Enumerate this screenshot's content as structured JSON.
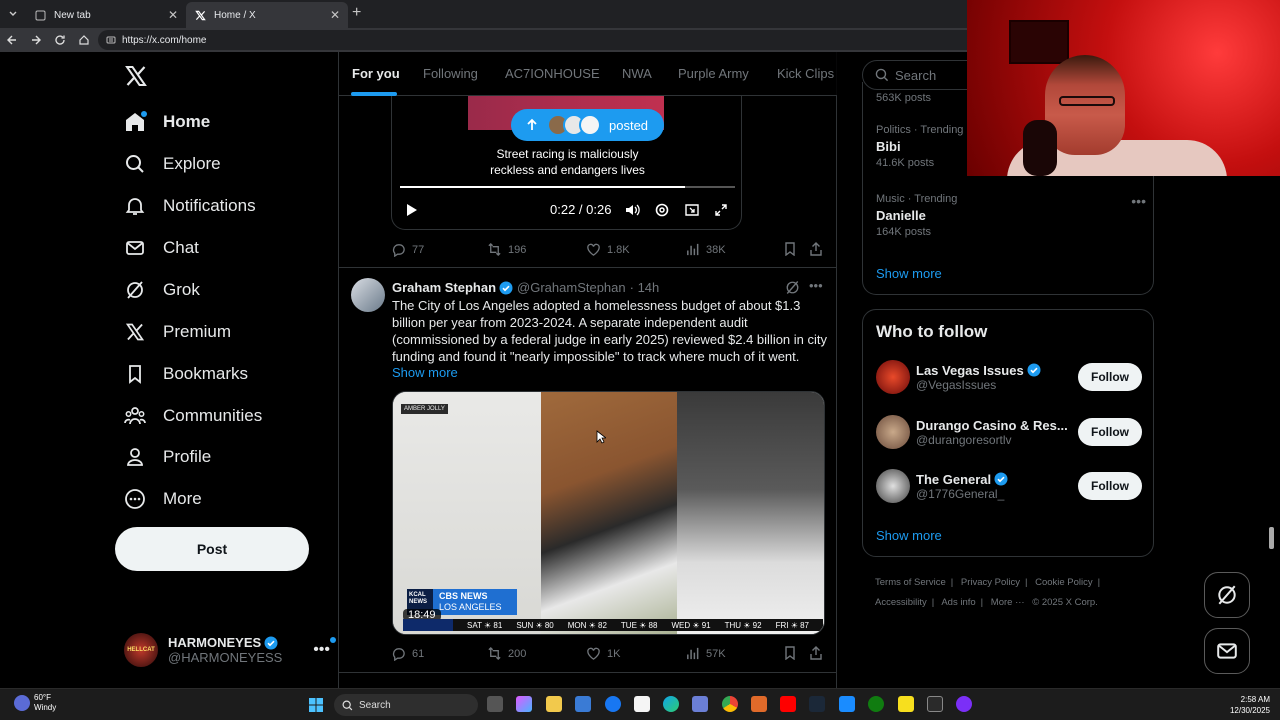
{
  "browser": {
    "tabs": [
      {
        "title": "New tab",
        "close": "✕"
      },
      {
        "title": "Home / X",
        "close": "✕"
      }
    ],
    "new_tab": "+",
    "url": "https://x.com/home"
  },
  "nav": {
    "items": [
      {
        "label": "Home",
        "icon": "home-icon"
      },
      {
        "label": "Explore",
        "icon": "search-icon"
      },
      {
        "label": "Notifications",
        "icon": "bell-icon"
      },
      {
        "label": "Chat",
        "icon": "mail-icon"
      },
      {
        "label": "Grok",
        "icon": "grok-icon"
      },
      {
        "label": "Premium",
        "icon": "x-icon"
      },
      {
        "label": "Bookmarks",
        "icon": "bookmark-icon"
      },
      {
        "label": "Communities",
        "icon": "people-icon"
      },
      {
        "label": "Profile",
        "icon": "person-icon"
      },
      {
        "label": "More",
        "icon": "more-circle-icon"
      }
    ],
    "post_label": "Post",
    "account": {
      "name": "HARMONEYES",
      "handle": "@HARMONEYESS",
      "avatar_text": "HELLCAT",
      "more": "•••"
    }
  },
  "feed": {
    "tabs": [
      "For you",
      "Following",
      "AC7IONHOUSE",
      "NWA",
      "Purple Army",
      "Kick Clips"
    ],
    "posted_pill": "posted",
    "video": {
      "caption_line1": "Street racing is maliciously",
      "caption_line2": "reckless and endangers lives",
      "time": "0:22 / 0:26",
      "progress": 0.85
    },
    "tweet1_actions": {
      "replies": "77",
      "reposts": "196",
      "likes": "1.8K",
      "views": "38K"
    },
    "tweet2": {
      "name": "Graham Stephan",
      "handle": "@GrahamStephan",
      "time": "· 14h",
      "text": "The City of Los Angeles adopted a homelessness budget of about $1.3 billion per year from 2023-2024. A separate independent audit (commissioned by a federal judge in early 2025) reviewed $2.4 billion in city funding and found it \"nearly impossible\" to track where much of it went.",
      "show_more": "Show more",
      "media": {
        "watermark": "AMBER JOLLY",
        "station": "KCAL NEWS",
        "network": "CBS NEWS",
        "network_sub": "LOS ANGELES",
        "duration": "18:49",
        "ticker": [
          "SAT ☀ 81",
          "SUN ☀ 80",
          "MON ☀ 82",
          "TUE ☀ 88",
          "WED ☀ 91",
          "THU ☀ 92",
          "FRI ☀ 87"
        ]
      },
      "actions": {
        "replies": "61",
        "reposts": "200",
        "likes": "1K",
        "views": "57K"
      },
      "more": "•••"
    }
  },
  "right": {
    "search_placeholder": "Search",
    "trends_top_count": "563K posts",
    "trends": [
      {
        "category": "Politics · Trending",
        "title": "Bibi",
        "count": "41.6K posts"
      },
      {
        "category": "Music · Trending",
        "title": "Danielle",
        "count": "164K posts",
        "more": "•••"
      }
    ],
    "trends_show_more": "Show more",
    "who_to_follow": {
      "title": "Who to follow",
      "accounts": [
        {
          "name": "Las Vegas Issues",
          "handle": "@VegasIssues",
          "verified": true
        },
        {
          "name": "Durango Casino & Res...",
          "handle": "@durangoresortlv",
          "verified": false
        },
        {
          "name": "The General",
          "handle": "@1776General_",
          "verified": true
        }
      ],
      "follow_label": "Follow",
      "show_more": "Show more"
    },
    "footer": [
      "Terms of Service",
      "|",
      "Privacy Policy",
      "|",
      "Cookie Policy",
      "|",
      "Accessibility",
      "|",
      "Ads info",
      "|",
      "More ···",
      "© 2025 X Corp."
    ]
  },
  "taskbar": {
    "weather_temp": "60°F",
    "weather_desc": "Windy",
    "search": "Search",
    "time": "2:58 AM",
    "date": "12/30/2025"
  },
  "colors": {
    "accent": "#1d9bf0",
    "bg": "#000000",
    "text": "#e7e9ea",
    "muted": "#71767b",
    "border": "#2f3336"
  }
}
